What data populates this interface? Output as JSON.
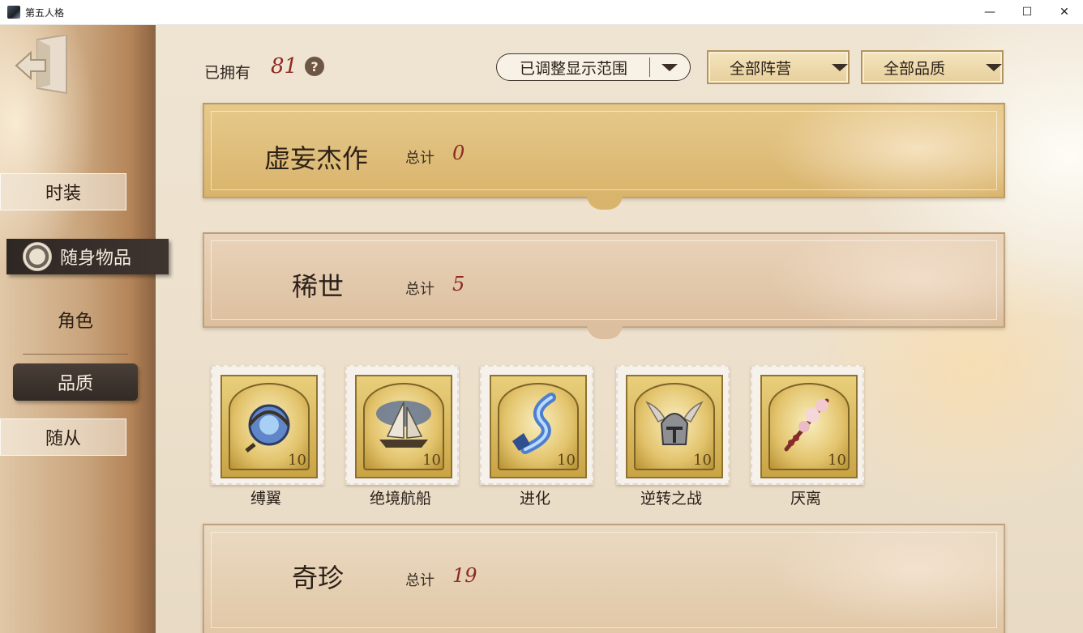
{
  "window": {
    "title": "第五人格",
    "minimize": "—",
    "maximize": "☐",
    "close": "✕"
  },
  "header": {
    "owned_label": "已拥有",
    "owned_count": "81",
    "help": "?",
    "range_filter": "已调整显示范围",
    "faction_filter": "全部阵营",
    "quality_filter": "全部品质"
  },
  "sidebar": {
    "items": [
      {
        "label": "时装"
      },
      {
        "label": "随身物品"
      },
      {
        "label": "角色"
      },
      {
        "label": "品质"
      },
      {
        "label": "随从"
      }
    ]
  },
  "groups": [
    {
      "title": "虚妄杰作",
      "total_label": "总计",
      "total": "0"
    },
    {
      "title": "稀世",
      "total_label": "总计",
      "total": "5"
    },
    {
      "title": "奇珍",
      "total_label": "总计",
      "total": "19"
    }
  ],
  "rare_items": [
    {
      "name": "缚翼",
      "icon": "astrolabe-icon",
      "stamp": "10"
    },
    {
      "name": "绝境航船",
      "icon": "sailing-ship-icon",
      "stamp": "10"
    },
    {
      "name": "进化",
      "icon": "evolution-crystal-icon",
      "stamp": "10"
    },
    {
      "name": "逆转之战",
      "icon": "winged-helmet-icon",
      "stamp": "10"
    },
    {
      "name": "厌离",
      "icon": "blossom-staff-icon",
      "stamp": "10"
    }
  ],
  "colors": {
    "accent_red": "#8e2a22",
    "gold_banner": "#d9b46c",
    "dark_tab": "#322a25"
  }
}
